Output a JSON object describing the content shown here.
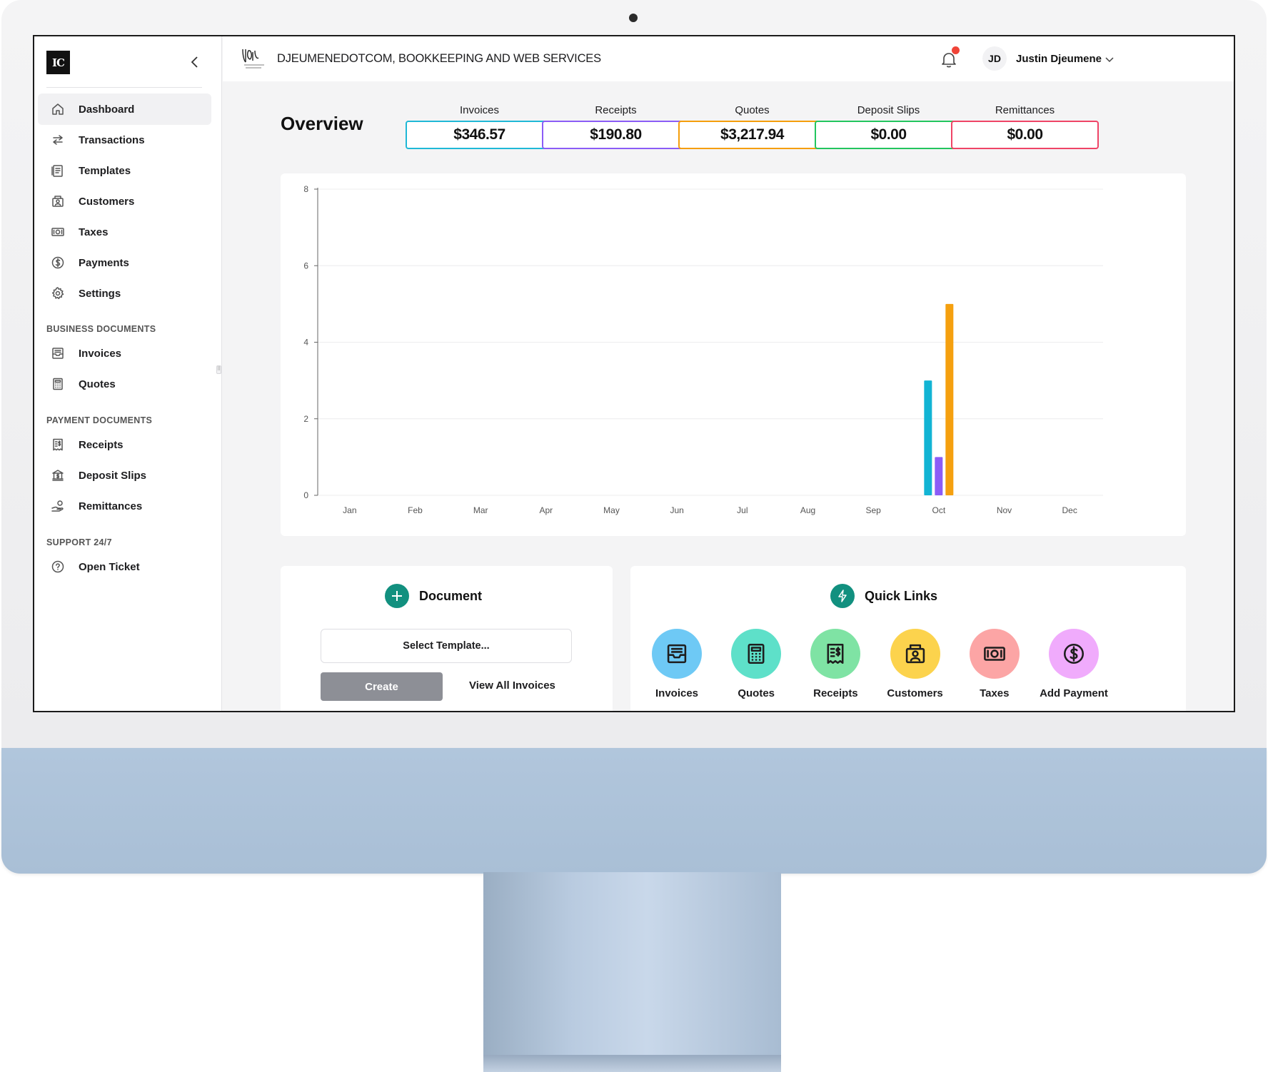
{
  "company": {
    "name": "DJEUMENEDOTCOM, BOOKKEEPING AND WEB SERVICES"
  },
  "logo": {
    "text": "IC"
  },
  "user": {
    "initials": "JD",
    "name": "Justin Djeumene"
  },
  "sidebar": {
    "main": [
      {
        "label": "Dashboard",
        "icon": "home-icon"
      },
      {
        "label": "Transactions",
        "icon": "arrows-icon"
      },
      {
        "label": "Templates",
        "icon": "templates-icon"
      },
      {
        "label": "Customers",
        "icon": "customers-icon"
      },
      {
        "label": "Taxes",
        "icon": "cash-icon"
      },
      {
        "label": "Payments",
        "icon": "dollar-circle-icon"
      },
      {
        "label": "Settings",
        "icon": "gear-icon"
      }
    ],
    "business_heading": "BUSINESS DOCUMENTS",
    "business": [
      {
        "label": "Invoices",
        "icon": "inbox-icon"
      },
      {
        "label": "Quotes",
        "icon": "calculator-icon"
      }
    ],
    "payment_heading": "PAYMENT DOCUMENTS",
    "payment": [
      {
        "label": "Receipts",
        "icon": "receipt-icon"
      },
      {
        "label": "Deposit Slips",
        "icon": "bank-icon"
      },
      {
        "label": "Remittances",
        "icon": "hand-coin-icon"
      }
    ],
    "support_heading": "SUPPORT 24/7",
    "support": [
      {
        "label": "Open Ticket",
        "icon": "help-circle-icon"
      }
    ]
  },
  "overview": {
    "title": "Overview",
    "stats": [
      {
        "label": "Invoices",
        "value": "$346.57",
        "color": "#1fb8d6"
      },
      {
        "label": "Receipts",
        "value": "$190.80",
        "color": "#8b5cf6"
      },
      {
        "label": "Quotes",
        "value": "$3,217.94",
        "color": "#f59e0b"
      },
      {
        "label": "Deposit Slips",
        "value": "$0.00",
        "color": "#22c55e"
      },
      {
        "label": "Remittances",
        "value": "$0.00",
        "color": "#ef4466"
      }
    ]
  },
  "chart_data": {
    "type": "bar",
    "categories": [
      "Jan",
      "Feb",
      "Mar",
      "Apr",
      "May",
      "Jun",
      "Jul",
      "Aug",
      "Sep",
      "Oct",
      "Nov",
      "Dec"
    ],
    "series": [
      {
        "values": [
          0,
          0,
          0,
          0,
          0,
          0,
          0,
          0,
          0,
          3,
          0,
          0
        ],
        "color": "#12b4d4"
      },
      {
        "values": [
          0,
          0,
          0,
          0,
          0,
          0,
          0,
          0,
          0,
          1,
          0,
          0
        ],
        "color": "#8b5cf6"
      },
      {
        "values": [
          0,
          0,
          0,
          0,
          0,
          0,
          0,
          0,
          0,
          5,
          0,
          0
        ],
        "color": "#f5a00f"
      }
    ],
    "yticks": [
      "0",
      "2",
      "4",
      "6",
      "8"
    ],
    "ylim": [
      0,
      8
    ],
    "grid": true,
    "legend": "none"
  },
  "document_card": {
    "title": "Document",
    "select_placeholder": "Select Template...",
    "create_label": "Create",
    "view_all_label": "View All Invoices"
  },
  "quick_links": {
    "title": "Quick Links",
    "items": [
      {
        "label": "Invoices",
        "icon": "inbox-icon",
        "color": "#6ec9f5"
      },
      {
        "label": "Quotes",
        "icon": "calculator-icon",
        "color": "#5ee0c9"
      },
      {
        "label": "Receipts",
        "icon": "receipt-icon",
        "color": "#7fe3a4"
      },
      {
        "label": "Customers",
        "icon": "customers-icon",
        "color": "#fcd34d"
      },
      {
        "label": "Taxes",
        "icon": "cash-icon",
        "color": "#fca5a5"
      },
      {
        "label": "Add Payment",
        "icon": "dollar-circle-icon",
        "color": "#f0abfc"
      }
    ]
  }
}
